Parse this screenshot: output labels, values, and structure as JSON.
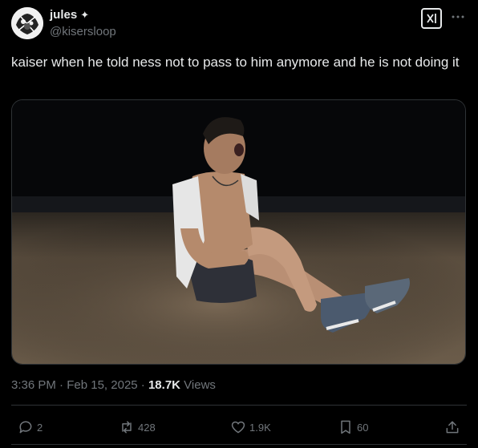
{
  "author": {
    "display_name": "jules",
    "name_glyph": "✦",
    "handle": "@kisersloop",
    "avatar_icon": "avatar-image"
  },
  "post": {
    "text": "kaiser when he told ness not to pass to him anymore and he is not doing it",
    "media_icon": "video-thumbnail"
  },
  "meta": {
    "time": "3:36 PM",
    "separator1": "·",
    "date": "Feb 15, 2025",
    "separator2": "·",
    "views_count": "18.7K",
    "views_label": "Views"
  },
  "actions": {
    "replies": "2",
    "reposts": "428",
    "likes": "1.9K",
    "bookmarks": "60"
  },
  "colors": {
    "background": "#000000",
    "text": "#e7e9ea",
    "muted": "#71767b",
    "border": "#2f3336"
  }
}
